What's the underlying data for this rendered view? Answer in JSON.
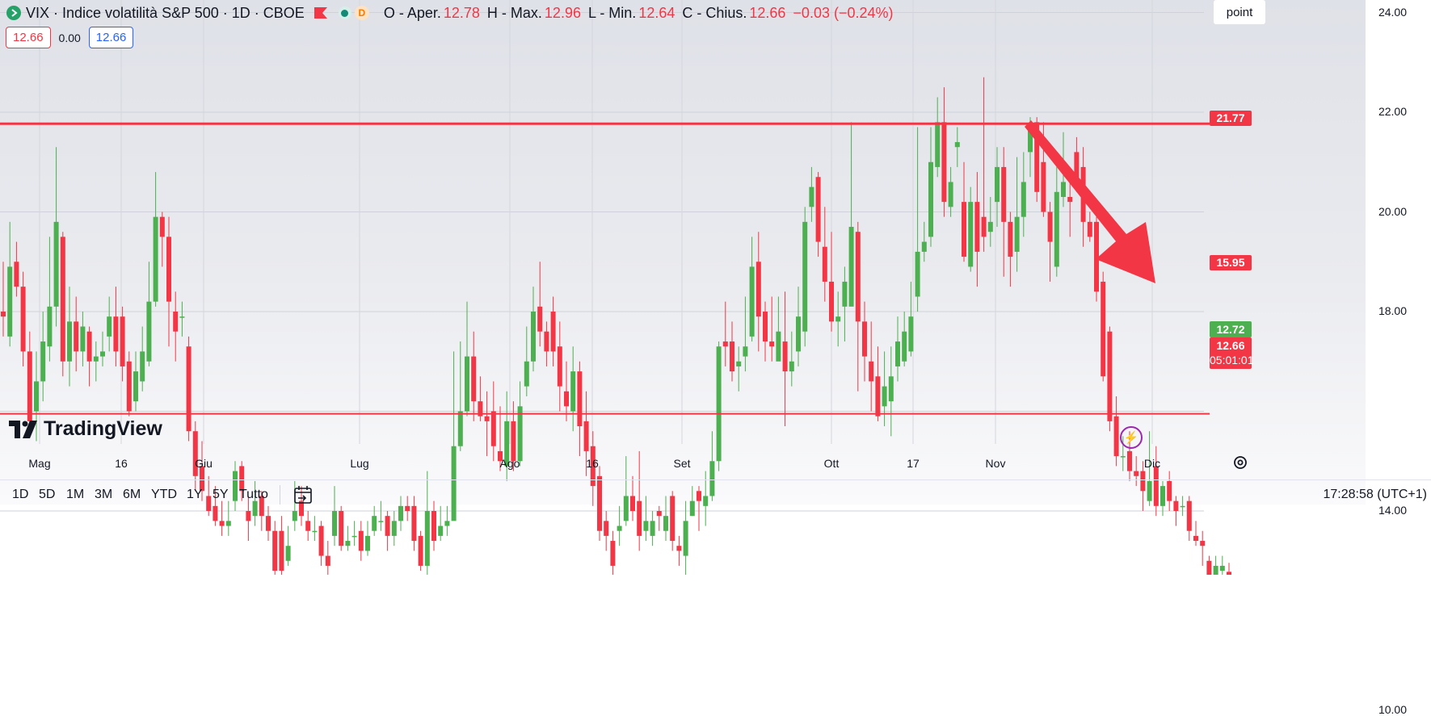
{
  "legend": {
    "symbol": "VIX · Indice volatilità S&P 500 · 1D · CBOE",
    "indicator_letter": "D",
    "open_label": "O - Aper.",
    "open_value": "12.78",
    "high_label": "H - Max.",
    "high_value": "12.96",
    "low_label": "L - Min.",
    "low_value": "12.64",
    "close_label": "C - Chius.",
    "close_value": "12.66",
    "change": "−0.03 (−0.24%)",
    "price_left": "12.66",
    "spread": "0.00",
    "price_right": "12.66"
  },
  "axis": {
    "unit": "point",
    "ticks": [
      "24.00",
      "22.00",
      "20.00",
      "18.00",
      "14.00",
      "10.00"
    ],
    "time_ticks": [
      "Mag",
      "16",
      "Giu",
      "Lug",
      "Ago",
      "16",
      "Set",
      "Ott",
      "17",
      "Nov",
      "Dic"
    ]
  },
  "price_labels": {
    "resistance": "21.77",
    "mid": "15.95",
    "green": "12.72",
    "last": "12.66",
    "countdown": "05:01:01"
  },
  "watermark": "TradingView",
  "timeframes": [
    "1D",
    "5D",
    "1M",
    "3M",
    "6M",
    "YTD",
    "1Y",
    "5Y",
    "Tutto"
  ],
  "clock": "17:28:58 (UTC+1)",
  "colors": {
    "up": "#4caf50",
    "down": "#f23645",
    "line_red": "#f23645",
    "line_green": "#4caf50",
    "arrow": "#f23645"
  },
  "chart_data": {
    "type": "candlestick",
    "y_range": [
      10,
      24
    ],
    "horizontal_lines": [
      {
        "value": 21.77,
        "color": "#f23645"
      },
      {
        "value": 15.95,
        "color": "#f23645"
      },
      {
        "value": 12.72,
        "color": "#4caf50"
      }
    ],
    "ohlc": [
      [
        18.0,
        17.9,
        19.0,
        17.5
      ],
      [
        17.5,
        18.9,
        19.8,
        17.3
      ],
      [
        19.0,
        18.5,
        19.4,
        18.3
      ],
      [
        18.5,
        17.2,
        18.8,
        16.9
      ],
      [
        17.2,
        15.8,
        17.6,
        15.6
      ],
      [
        16.0,
        16.6,
        17.2,
        15.4
      ],
      [
        16.6,
        17.4,
        18.0,
        16.2
      ],
      [
        17.3,
        18.1,
        19.5,
        17.0
      ],
      [
        18.1,
        19.8,
        21.3,
        17.7
      ],
      [
        19.5,
        17.0,
        19.6,
        16.7
      ],
      [
        17.0,
        17.8,
        18.5,
        16.5
      ],
      [
        17.8,
        17.2,
        18.3,
        16.8
      ],
      [
        17.2,
        17.7,
        18.0,
        16.9
      ],
      [
        17.6,
        17.0,
        17.7,
        16.5
      ],
      [
        17.0,
        17.1,
        17.4,
        16.6
      ],
      [
        17.1,
        17.2,
        17.6,
        16.9
      ],
      [
        17.5,
        17.9,
        18.3,
        17.2
      ],
      [
        17.9,
        17.2,
        18.5,
        16.9
      ],
      [
        17.9,
        16.9,
        18.1,
        16.6
      ],
      [
        17.0,
        16.0,
        17.2,
        15.9
      ],
      [
        16.2,
        16.8,
        17.2,
        16.0
      ],
      [
        16.6,
        17.2,
        17.7,
        16.4
      ],
      [
        17.0,
        18.2,
        19.0,
        16.9
      ],
      [
        18.2,
        19.9,
        20.8,
        18.1
      ],
      [
        19.9,
        19.5,
        20.0,
        18.9
      ],
      [
        19.5,
        18.2,
        19.9,
        17.3
      ],
      [
        18.0,
        17.6,
        18.4,
        17.0
      ],
      [
        17.9,
        17.9,
        18.2,
        17.5
      ],
      [
        17.3,
        15.6,
        17.5,
        15.4
      ],
      [
        15.6,
        14.7,
        15.8,
        14.4
      ],
      [
        14.9,
        14.4,
        15.4,
        14.2
      ],
      [
        14.3,
        14.0,
        14.7,
        13.9
      ],
      [
        14.1,
        13.8,
        14.5,
        13.7
      ],
      [
        13.8,
        13.7,
        14.2,
        13.5
      ],
      [
        13.7,
        13.8,
        14.2,
        13.5
      ],
      [
        14.2,
        14.8,
        15.0,
        14.0
      ],
      [
        14.9,
        14.4,
        15.0,
        14.2
      ],
      [
        14.0,
        13.8,
        14.3,
        13.4
      ],
      [
        13.9,
        14.2,
        14.6,
        13.7
      ],
      [
        14.3,
        13.9,
        14.4,
        13.6
      ],
      [
        13.9,
        13.6,
        14.1,
        13.4
      ],
      [
        13.6,
        12.8,
        13.8,
        12.6
      ],
      [
        13.6,
        12.8,
        13.9,
        12.7
      ],
      [
        13.0,
        13.3,
        13.7,
        12.9
      ],
      [
        13.8,
        14.0,
        14.6,
        13.6
      ],
      [
        14.2,
        13.9,
        14.5,
        13.7
      ],
      [
        13.8,
        13.6,
        14.0,
        13.4
      ],
      [
        13.6,
        13.6,
        13.9,
        13.4
      ],
      [
        13.7,
        13.1,
        13.8,
        12.9
      ],
      [
        13.1,
        12.9,
        13.4,
        12.7
      ],
      [
        13.5,
        14.0,
        14.5,
        13.3
      ],
      [
        14.0,
        13.3,
        14.1,
        13.2
      ],
      [
        13.3,
        13.4,
        13.7,
        13.2
      ],
      [
        13.5,
        13.5,
        13.8,
        13.3
      ],
      [
        13.6,
        13.2,
        13.8,
        13.0
      ],
      [
        13.2,
        13.5,
        13.8,
        13.1
      ],
      [
        13.6,
        13.9,
        14.1,
        13.5
      ],
      [
        13.8,
        13.8,
        14.2,
        13.6
      ],
      [
        13.9,
        13.5,
        14.0,
        13.2
      ],
      [
        13.5,
        13.8,
        14.0,
        13.3
      ],
      [
        13.8,
        14.1,
        14.3,
        13.6
      ],
      [
        14.1,
        14.0,
        14.3,
        13.8
      ],
      [
        14.1,
        13.4,
        14.3,
        13.2
      ],
      [
        13.5,
        12.9,
        13.6,
        12.8
      ],
      [
        12.9,
        14.0,
        14.8,
        12.7
      ],
      [
        14.0,
        13.4,
        14.2,
        13.2
      ],
      [
        13.5,
        13.7,
        14.1,
        13.4
      ],
      [
        13.7,
        13.8,
        14.1,
        13.5
      ],
      [
        13.8,
        15.3,
        17.2,
        15.0
      ],
      [
        15.3,
        16.0,
        17.4,
        15.2
      ],
      [
        16.0,
        17.1,
        18.2,
        15.9
      ],
      [
        17.1,
        16.2,
        17.6,
        15.8
      ],
      [
        16.2,
        15.9,
        16.7,
        15.8
      ],
      [
        15.9,
        15.8,
        16.4,
        15.1
      ],
      [
        16.0,
        15.3,
        16.6,
        15.0
      ],
      [
        15.2,
        15.0,
        16.1,
        14.8
      ],
      [
        14.9,
        15.8,
        16.4,
        14.6
      ],
      [
        15.8,
        15.0,
        16.2,
        14.8
      ],
      [
        15.0,
        16.1,
        16.6,
        14.9
      ],
      [
        16.5,
        17.0,
        17.7,
        16.3
      ],
      [
        17.0,
        18.0,
        18.5,
        16.8
      ],
      [
        18.1,
        17.6,
        19.0,
        17.3
      ],
      [
        17.6,
        17.2,
        17.8,
        16.9
      ],
      [
        18.0,
        17.2,
        18.3,
        16.9
      ],
      [
        17.3,
        16.5,
        17.8,
        16.0
      ],
      [
        16.4,
        16.1,
        17.0,
        15.8
      ],
      [
        16.0,
        16.8,
        17.3,
        15.6
      ],
      [
        16.8,
        15.7,
        17.0,
        15.1
      ],
      [
        15.8,
        15.2,
        16.4,
        14.7
      ],
      [
        15.3,
        14.5,
        15.6,
        14.1
      ],
      [
        14.7,
        13.6,
        14.9,
        13.4
      ],
      [
        13.8,
        13.5,
        14.0,
        13.2
      ],
      [
        13.4,
        12.9,
        13.6,
        12.7
      ],
      [
        13.6,
        13.7,
        14.1,
        13.3
      ],
      [
        13.8,
        14.3,
        15.1,
        13.7
      ],
      [
        14.3,
        14.0,
        14.7,
        13.8
      ],
      [
        14.2,
        13.5,
        15.2,
        13.2
      ],
      [
        13.6,
        13.8,
        14.3,
        13.4
      ],
      [
        13.5,
        13.8,
        14.0,
        13.3
      ],
      [
        14.0,
        13.9,
        14.1,
        13.6
      ],
      [
        13.6,
        13.9,
        14.3,
        13.4
      ],
      [
        14.3,
        13.4,
        14.4,
        13.2
      ],
      [
        13.3,
        13.2,
        13.5,
        12.9
      ],
      [
        13.1,
        13.8,
        14.2,
        12.6
      ],
      [
        13.9,
        14.2,
        14.5,
        13.9
      ],
      [
        14.4,
        14.2,
        14.5,
        13.6
      ],
      [
        14.1,
        14.3,
        14.8,
        13.7
      ],
      [
        14.3,
        15.0,
        15.6,
        14.2
      ],
      [
        15.0,
        17.3,
        17.4,
        14.8
      ],
      [
        17.4,
        17.3,
        18.2,
        16.9
      ],
      [
        17.4,
        16.8,
        17.8,
        16.6
      ],
      [
        16.9,
        17.0,
        17.3,
        16.4
      ],
      [
        17.1,
        17.3,
        18.3,
        16.8
      ],
      [
        17.5,
        18.9,
        19.5,
        17.4
      ],
      [
        19.0,
        17.9,
        19.6,
        17.2
      ],
      [
        18.0,
        17.4,
        18.2,
        17.0
      ],
      [
        17.4,
        17.3,
        18.3,
        17.0
      ],
      [
        17.0,
        17.6,
        18.3,
        17.2
      ],
      [
        17.4,
        16.8,
        18.4,
        15.7
      ],
      [
        16.8,
        17.0,
        17.6,
        16.5
      ],
      [
        17.2,
        17.9,
        18.5,
        16.9
      ],
      [
        17.6,
        19.8,
        20.1,
        17.3
      ],
      [
        20.1,
        20.5,
        20.9,
        19.8
      ],
      [
        20.7,
        19.4,
        20.8,
        19.1
      ],
      [
        19.3,
        18.6,
        20.1,
        18.2
      ],
      [
        18.6,
        17.8,
        19.6,
        17.6
      ],
      [
        17.8,
        17.9,
        18.4,
        17.3
      ],
      [
        18.1,
        18.6,
        18.9,
        17.4
      ],
      [
        18.1,
        19.7,
        21.8,
        19.3
      ],
      [
        19.6,
        17.8,
        19.8,
        16.4
      ],
      [
        17.8,
        17.1,
        18.2,
        16.6
      ],
      [
        17.0,
        16.6,
        17.8,
        16.0
      ],
      [
        16.7,
        15.9,
        17.3,
        15.8
      ],
      [
        16.1,
        16.5,
        17.2,
        15.7
      ],
      [
        16.2,
        16.7,
        17.3,
        15.5
      ],
      [
        16.9,
        17.4,
        17.9,
        16.6
      ],
      [
        17.0,
        17.6,
        18.0,
        16.9
      ],
      [
        17.2,
        17.9,
        18.6,
        17.1
      ],
      [
        18.3,
        19.2,
        21.7,
        18.0
      ],
      [
        19.2,
        19.4,
        19.8,
        19.0
      ],
      [
        19.5,
        21.0,
        21.7,
        19.3
      ],
      [
        20.9,
        21.8,
        22.3,
        20.7
      ],
      [
        21.8,
        20.2,
        22.5,
        19.9
      ],
      [
        20.1,
        20.6,
        20.9,
        19.9
      ],
      [
        21.3,
        21.4,
        21.7,
        20.9
      ],
      [
        20.2,
        19.1,
        21.0,
        19.0
      ],
      [
        18.9,
        20.2,
        20.5,
        18.8
      ],
      [
        20.2,
        19.2,
        20.8,
        18.5
      ],
      [
        19.9,
        19.5,
        22.7,
        19.2
      ],
      [
        19.6,
        19.8,
        20.3,
        19.3
      ],
      [
        20.2,
        20.9,
        21.3,
        19.7
      ],
      [
        20.9,
        19.8,
        21.3,
        18.7
      ],
      [
        19.8,
        19.1,
        20.0,
        18.5
      ],
      [
        19.2,
        19.9,
        21.1,
        18.8
      ],
      [
        19.9,
        20.6,
        21.2,
        19.5
      ],
      [
        21.2,
        21.7,
        21.9,
        20.7
      ],
      [
        21.8,
        20.4,
        21.9,
        20.2
      ],
      [
        21.0,
        20.0,
        21.8,
        19.9
      ],
      [
        20.0,
        19.4,
        20.2,
        18.6
      ],
      [
        18.9,
        20.4,
        20.9,
        18.7
      ],
      [
        20.3,
        20.6,
        21.6,
        20.1
      ],
      [
        20.3,
        20.2,
        20.7,
        19.5
      ],
      [
        21.2,
        20.6,
        21.5,
        20.4
      ],
      [
        20.9,
        19.8,
        21.3,
        19.3
      ],
      [
        19.8,
        19.5,
        20.0,
        19.4
      ],
      [
        19.8,
        18.4,
        19.9,
        18.2
      ],
      [
        18.6,
        16.7,
        18.8,
        16.6
      ],
      [
        17.6,
        15.8,
        17.7,
        15.6
      ],
      [
        15.9,
        15.1,
        16.3,
        14.9
      ],
      [
        15.1,
        15.1,
        15.5,
        14.8
      ],
      [
        15.2,
        14.8,
        15.6,
        14.6
      ],
      [
        14.8,
        14.7,
        15.1,
        14.5
      ],
      [
        14.8,
        14.4,
        15.0,
        14.0
      ],
      [
        14.2,
        14.6,
        15.6,
        14.1
      ],
      [
        14.9,
        14.1,
        15.3,
        13.9
      ],
      [
        14.1,
        14.5,
        14.6,
        13.9
      ],
      [
        14.6,
        14.2,
        14.8,
        14.0
      ],
      [
        14.2,
        14.0,
        14.3,
        13.7
      ],
      [
        14.1,
        14.1,
        14.3,
        13.9
      ],
      [
        14.2,
        13.6,
        14.3,
        13.4
      ],
      [
        13.5,
        13.4,
        13.8,
        13.3
      ],
      [
        13.4,
        13.3,
        13.6,
        12.9
      ],
      [
        13.0,
        12.6,
        13.1,
        12.5
      ],
      [
        12.6,
        12.9,
        13.1,
        12.7
      ],
      [
        12.8,
        12.9,
        13.1,
        12.6
      ],
      [
        12.78,
        12.66,
        12.96,
        12.64
      ]
    ]
  }
}
